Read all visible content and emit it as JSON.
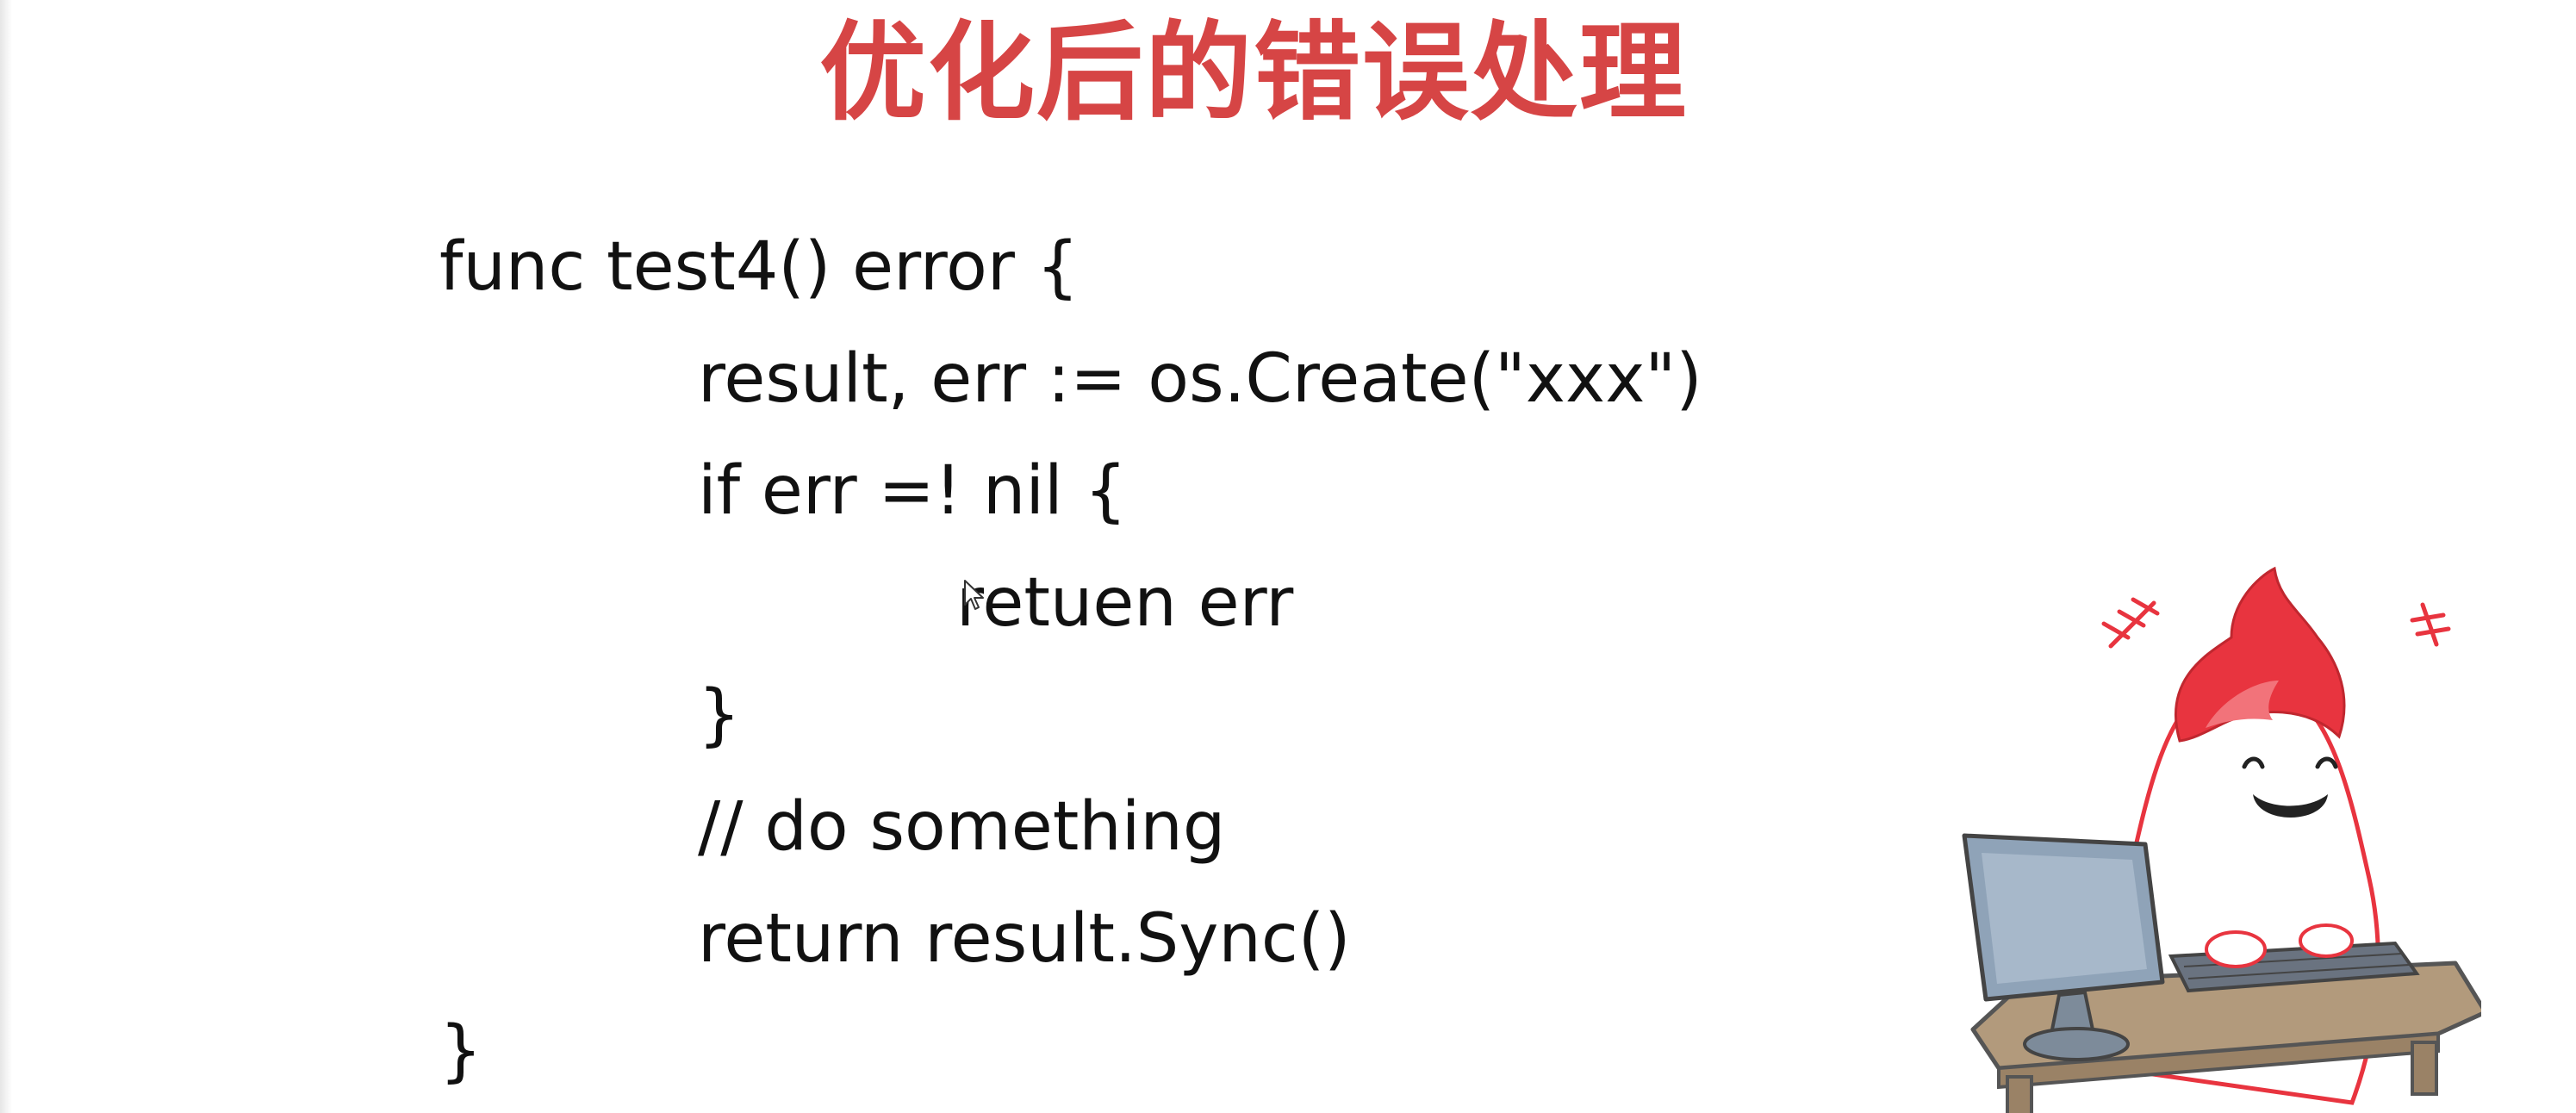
{
  "slide": {
    "title": "优化后的错误处理",
    "title_color": "#d64545",
    "code_lines": [
      {
        "text": "func test4() error {",
        "indent": 0
      },
      {
        "text": "result, err := os.Create(\"xxx\")",
        "indent": 1
      },
      {
        "text": "if err =! nil {",
        "indent": 1
      },
      {
        "text": "retuen err",
        "indent": 2
      },
      {
        "text": "}",
        "indent": 1
      },
      {
        "text": "// do something",
        "indent": 1
      },
      {
        "text": "return result.Sync()",
        "indent": 1
      },
      {
        "text": "}",
        "indent": 0
      }
    ]
  },
  "icons": {
    "cursor": "mouse-pointer-icon",
    "mascot": "flame-head-mascot-at-computer-icon"
  },
  "colors": {
    "flame_red": "#e8343f",
    "body_white": "#ffffff",
    "monitor_gray": "#8fa3b8",
    "desk_tan": "#b29a7c",
    "outline": "#555555"
  }
}
